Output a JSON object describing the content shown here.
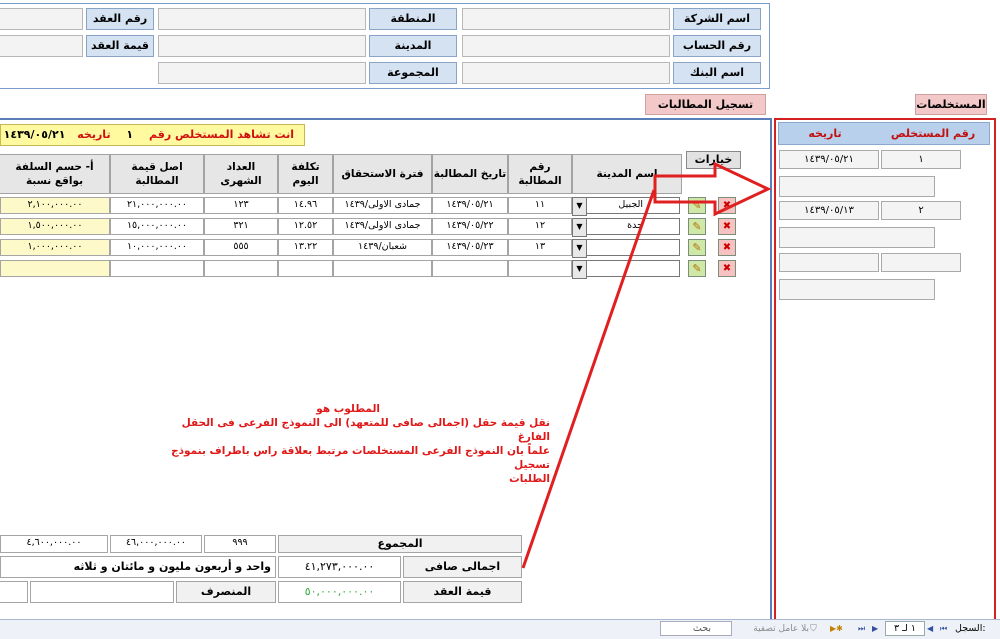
{
  "header": {
    "company_label": "اسم الشركة",
    "account_label": "رقم الحساب",
    "bank_label": "اسم البنك",
    "region_label": "المنطقة",
    "city_label": "المدينة",
    "group_label": "المجموعة",
    "contract_no_label": "رقم العقد",
    "contract_value_label": "قيمة العقد"
  },
  "tabs": {
    "claims_title": "تسجيل المطالبات",
    "extracts_title": "المستخلصات"
  },
  "banner": {
    "text": "انت تشاهد المستخلص رقم",
    "number": "١",
    "date_label": "تاريخه",
    "date": "١٤٣٩/٠٥/٢١"
  },
  "options_label": "خيارات",
  "columns": [
    "اسم المدينة",
    "رقم المطالبة",
    "تاريخ المطالبة",
    "فترة الاستحقاق",
    "تكلفة اليوم",
    "العداد الشهرى",
    "اصل قيمة المطالبة",
    "أ- حسم السلفة بواقع نسبة"
  ],
  "rows": [
    {
      "city": "الجبيل",
      "claim_no": "١١",
      "claim_date": "١٤٣٩/٠٥/٢١",
      "period": "جمادى الاولى/١٤٣٩",
      "day_cost": "١٤.٩٦",
      "meter": "١٢٣",
      "original": "٢١,٠٠٠,٠٠٠.٠٠",
      "deduction": "٢,١٠٠,٠٠٠.٠٠"
    },
    {
      "city": "جدة",
      "claim_no": "١٢",
      "claim_date": "١٤٣٩/٠٥/٢٢",
      "period": "جمادى الاولى/١٤٣٩",
      "day_cost": "١٢.٥٢",
      "meter": "٣٢١",
      "original": "١٥,٠٠٠,٠٠٠.٠٠",
      "deduction": "١,٥٠٠,٠٠٠.٠٠"
    },
    {
      "city": "",
      "claim_no": "١٣",
      "claim_date": "١٤٣٩/٠٥/٢٣",
      "period": "شعبان/١٤٣٩",
      "day_cost": "١٣.٢٢",
      "meter": "٥٥٥",
      "original": "١٠,٠٠٠,٠٠٠.٠٠",
      "deduction": "١,٠٠٠,٠٠٠.٠٠"
    },
    {
      "city": "",
      "claim_no": "",
      "claim_date": "",
      "period": "",
      "day_cost": "",
      "meter": "",
      "original": "",
      "deduction": ""
    }
  ],
  "note": {
    "line1": "المطلوب هو",
    "line2": "نقل قيمة حقل (اجمالى صافى للمتعهد) الى النموذج الفرعى فى الحقل الفارغ",
    "line3": "علماً بان النموذج الفرعى المستخلصات مرتبط بعلاقة راس باطراف بنموذج تسجيل",
    "line4": "الطلبات"
  },
  "totals": {
    "sum_label": "المجموع",
    "meter_total": "٩٩٩",
    "original_total": "٤٦,٠٠٠,٠٠٠.٠٠",
    "deduction_total": "٤,٦٠٠,٠٠٠.٠٠",
    "net_label": "اجمالى صافى للمتعهد",
    "net_value": "٤١,٢٧٣,٠٠٠.٠٠",
    "words": "واحد و أربعون مليون و مائتان و ثلاثه",
    "contract_label": "قيمة العقد",
    "contract_value": "٥٠,٠٠٠,٠٠٠.٠٠",
    "spent_label": "المنصرف"
  },
  "extracts": {
    "col_no": "رقم المستخلص",
    "col_date": "تاريخه",
    "items": [
      {
        "no": "١",
        "date": "١٤٣٩/٠٥/٢١"
      },
      {
        "no": "٢",
        "date": "١٤٣٩/٠٥/١٣"
      }
    ]
  },
  "status": {
    "record_label": "السجل:",
    "record_pos": "١ لـ ٣",
    "no_filter": "بلا عامل تصفية",
    "search": "بحث"
  },
  "colors": {
    "arrow": "#e02020",
    "highlight": "#fffaa0",
    "banner_text": "#d01010",
    "green_value": "#2fa838"
  }
}
